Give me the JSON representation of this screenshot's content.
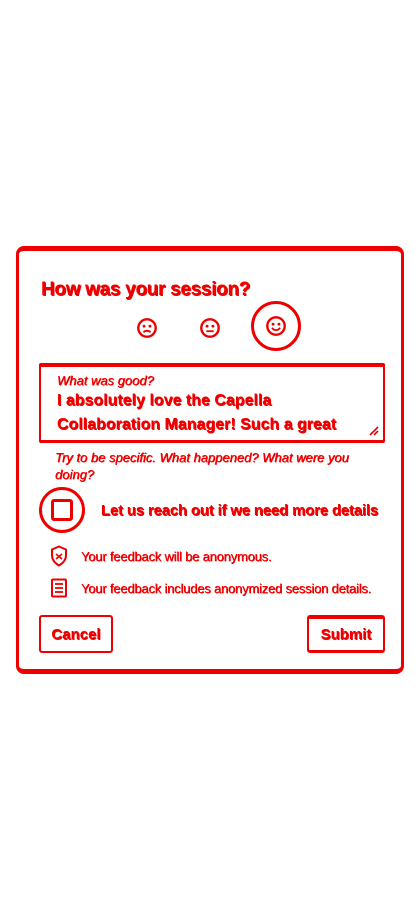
{
  "dialog": {
    "title": "How was your session?",
    "ratings": [
      "sad-face-icon",
      "neutral-face-icon",
      "happy-face-icon"
    ],
    "selected_rating": "happy",
    "feedback": {
      "label": "What was good?",
      "value": "I absolutely love the Capella Collaboration Manager! Such a great"
    },
    "hint": "Try to be specific. What happened? What were you doing?",
    "contact": {
      "label": "Let us reach out if we need more details",
      "checked": false
    },
    "info": {
      "anonymous": "Your feedback will be anonymous.",
      "session_details": "Your feedback includes anonymized session details."
    },
    "buttons": {
      "cancel": "Cancel",
      "submit": "Submit"
    }
  },
  "colors": {
    "accent": "#ee0000",
    "background": "#ffffff"
  }
}
